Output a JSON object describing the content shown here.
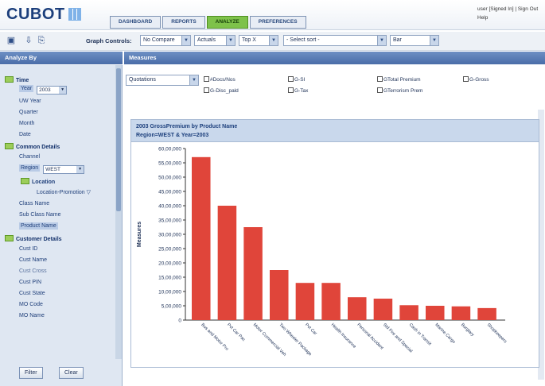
{
  "header": {
    "logo": "CUBOT",
    "tabs": [
      {
        "label": "DASHBOARD",
        "active": false
      },
      {
        "label": "REPORTS",
        "active": false
      },
      {
        "label": "ANALYZE",
        "active": true
      },
      {
        "label": "PREFERENCES",
        "active": false
      }
    ],
    "user_line": "user [Signed In] | Sign Out",
    "help": "Help"
  },
  "toolbar": {
    "icons": [
      "save-icon",
      "export-icon",
      "print-icon"
    ],
    "graph_controls_label": "Graph Controls:",
    "selects": [
      {
        "value": "No Compare"
      },
      {
        "value": "Actuals"
      },
      {
        "value": "Top X"
      },
      {
        "value": "- Select sort -"
      },
      {
        "value": "Bar"
      }
    ]
  },
  "left_panel": {
    "title": "Analyze By",
    "time_group": "Time",
    "year_label": "Year",
    "year_value": "2003",
    "time_items": [
      "UW Year",
      "Quarter",
      "Month",
      "Date"
    ],
    "common_group": "Common Details",
    "common_items_top": [
      "Channel"
    ],
    "region_label": "Region",
    "region_value": "WEST",
    "location_group": "Location",
    "location_promotion": "Location-Promotion",
    "common_items": [
      "Class Name",
      "Sub Class Name",
      "Product Name"
    ],
    "selected_item": "Product Name",
    "customer_group": "Customer Details",
    "customer_items": [
      "Cust ID",
      "Cust Name",
      "Cust Cross",
      "Cust PIN",
      "Cust State",
      "MO Code",
      "MO Name"
    ],
    "filter_button": "Filter",
    "clear_button": "Clear"
  },
  "measures": {
    "title": "Measures",
    "dropdown_value": "Quotations",
    "checkboxes": [
      {
        "label": "#Docs/Nos",
        "checked": false
      },
      {
        "label": "G-Disc_pald",
        "checked": false
      },
      {
        "label": "G-SI",
        "checked": false
      },
      {
        "label": "G-Tax",
        "checked": false
      },
      {
        "label": "GTotal Premium",
        "checked": false
      },
      {
        "label": "GTerrorism Prem",
        "checked": false
      },
      {
        "label": "G-Gross",
        "checked": false
      }
    ]
  },
  "chart": {
    "title_line1": "2003 GrossPremium by Product Name",
    "title_line2": "Region=WEST & Year=2003"
  },
  "chart_data": {
    "type": "bar",
    "title": "2003 GrossPremium by Product Name",
    "subtitle": "Region=WEST & Year=2003",
    "ylabel": "Measures",
    "xlabel": "",
    "ylim": [
      0,
      6000000
    ],
    "yticks": [
      "0",
      "5,00,000",
      "10,00,000",
      "15,00,000",
      "20,00,000",
      "25,00,000",
      "30,00,000",
      "35,00,000",
      "40,00,000",
      "45,00,000",
      "50,00,000",
      "55,00,000",
      "60,00,000"
    ],
    "ytick_values": [
      0,
      500000,
      1000000,
      1500000,
      2000000,
      2500000,
      3000000,
      3500000,
      4000000,
      4500000,
      5000000,
      5500000,
      6000000
    ],
    "categories": [
      "Bus and Motor Pro",
      "Pvt Car Pac",
      "Motor Commercial Veh",
      "Two Wheeler Package",
      "Pvt Car",
      "Health Insurance",
      "Personal Accident",
      "Std Fire and Special",
      "Cash in Transit",
      "Marine Cargo",
      "Burglary",
      "Shopkeepers"
    ],
    "values": [
      5700000,
      4000000,
      3250000,
      1750000,
      1300000,
      1300000,
      800000,
      750000,
      520000,
      500000,
      480000,
      420000
    ],
    "bar_color": "#e0453a",
    "grid": false,
    "legend": "none"
  }
}
